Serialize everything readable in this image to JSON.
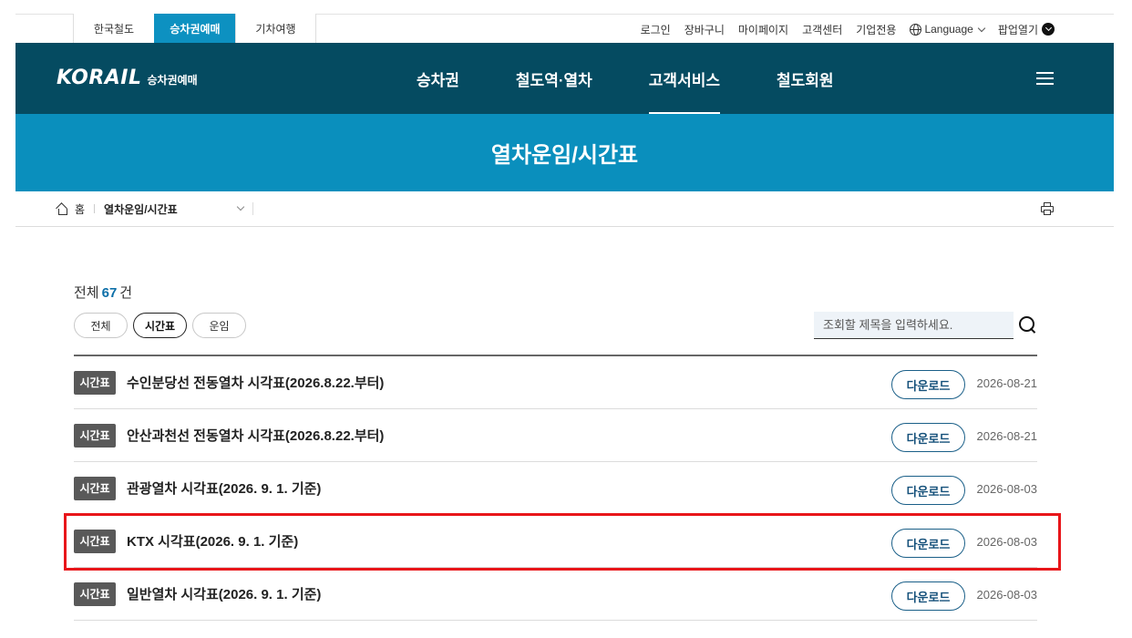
{
  "util_tabs": [
    {
      "label": "한국철도",
      "active": false
    },
    {
      "label": "승차권예매",
      "active": true
    },
    {
      "label": "기차여행",
      "active": false
    }
  ],
  "util_links": {
    "login": "로그인",
    "cart": "장바구니",
    "mypage": "마이페이지",
    "customer_center": "고객센터",
    "corporate": "기업전용",
    "language": "Language",
    "popup": "팝업열기"
  },
  "logo": {
    "main": "KORAIL",
    "sub": "승차권예매"
  },
  "nav": [
    {
      "label": "승차권",
      "active": false
    },
    {
      "label": "철도역·열차",
      "active": false
    },
    {
      "label": "고객서비스",
      "active": true
    },
    {
      "label": "철도회원",
      "active": false
    }
  ],
  "banner": {
    "title": "열차운임/시간표"
  },
  "breadcrumb": {
    "home": "홈",
    "current": "열차운임/시간표"
  },
  "count": {
    "prefix": "전체",
    "value": "67",
    "suffix": "건"
  },
  "filters": [
    {
      "label": "전체",
      "active": false
    },
    {
      "label": "시간표",
      "active": true
    },
    {
      "label": "운임",
      "active": false
    }
  ],
  "search": {
    "placeholder": "조회할 제목을 입력하세요."
  },
  "rows": [
    {
      "badge": "시간표",
      "title": "수인분당선 전동열차 시각표(2026.8.22.부터)",
      "button": "다운로드",
      "date": "2026-08-21"
    },
    {
      "badge": "시간표",
      "title": "안산과천선 전동열차 시각표(2026.8.22.부터)",
      "button": "다운로드",
      "date": "2026-08-21"
    },
    {
      "badge": "시간표",
      "title": "관광열차 시각표(2026. 9. 1. 기준)",
      "button": "다운로드",
      "date": "2026-08-03"
    },
    {
      "badge": "시간표",
      "title": "KTX 시각표(2026. 9. 1. 기준)",
      "button": "다운로드",
      "date": "2026-08-03"
    },
    {
      "badge": "시간표",
      "title": "일반열차 시각표(2026. 9. 1. 기준)",
      "button": "다운로드",
      "date": "2026-08-03"
    }
  ],
  "colors": {
    "navbar": "#054b61",
    "banner": "#0a8fbd",
    "active_tab": "#0d91c1",
    "highlight": "#e8161a"
  }
}
